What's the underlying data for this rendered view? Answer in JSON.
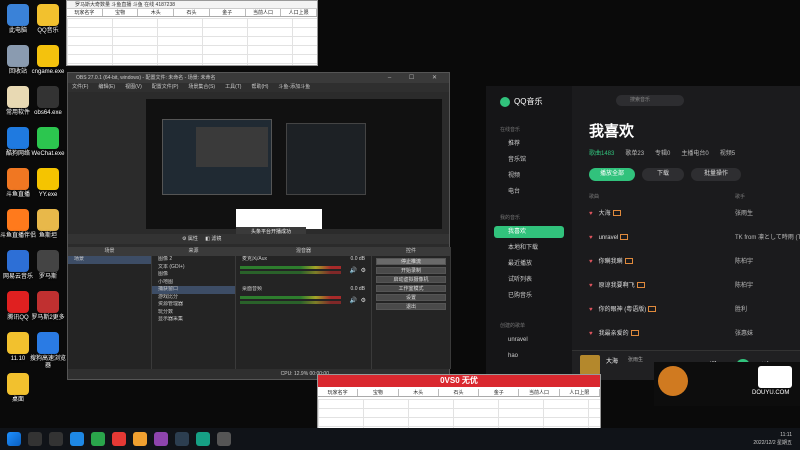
{
  "desktop_icons": [
    {
      "label": "此电脑",
      "color": "#3a82d8"
    },
    {
      "label": "QQ音乐",
      "color": "#f2c12e"
    },
    {
      "label": "回收站",
      "color": "#8a9bb0"
    },
    {
      "label": "cngame.exe",
      "color": "#f4c20d"
    },
    {
      "label": "常用软件",
      "color": "#e8d9b3"
    },
    {
      "label": "obs64.exe",
      "color": "#333333"
    },
    {
      "label": "酷狗网络",
      "color": "#1f7ae0"
    },
    {
      "label": "WeChat.exe",
      "color": "#2cc64f"
    },
    {
      "label": "斗鱼直播",
      "color": "#f07722"
    },
    {
      "label": "YY.exe",
      "color": "#f5c400"
    },
    {
      "label": "斗鱼直播伴侣",
      "color": "#ff7a1c"
    },
    {
      "label": "鱼斯坦",
      "color": "#e8b84a"
    },
    {
      "label": "网易云音乐",
      "color": "#2d6fd6"
    },
    {
      "label": "罗马斯",
      "color": "#444444"
    },
    {
      "label": "腾讯QQ",
      "color": "#e02020"
    },
    {
      "label": "罗马斯2更多",
      "color": "#c03030"
    },
    {
      "label": "11.10",
      "color": "#f2c12e"
    },
    {
      "label": "搜狗高速浏览器",
      "color": "#2a7be4"
    },
    {
      "label": "桌面",
      "color": "#f2c12e"
    }
  ],
  "sheet_top": {
    "title": "罗马斯大奇数量 斗鱼直播 斗鱼 在线 4187238",
    "columns": [
      "玩家名字",
      "宝物",
      "木头",
      "石头",
      "金子",
      "当前人口",
      "人口上限"
    ]
  },
  "sheet_bottom": {
    "columns": [
      "玩家名字",
      "宝物",
      "木头",
      "石头",
      "金子",
      "当前人口",
      "人口上限"
    ],
    "banner": "0VS0 无优"
  },
  "obs": {
    "title": "OBS 27.0.1 (64-bit, windows) - 配置文件: 未命名 - 场景: 未命名",
    "menu": [
      "文件(F)",
      "编辑(E)",
      "视图(V)",
      "配置文件(P)",
      "场景集合(S)",
      "工具(T)",
      "帮助(H)",
      "斗鱼-添加斗鱼"
    ],
    "toast": "头条平台开播成功",
    "toolbar": {
      "props": "属性",
      "filters": "滤镜"
    },
    "docks": {
      "scenes": "场景",
      "sources": "来源",
      "mixer": "混音器",
      "controls": "控件"
    },
    "scene_items": [
      "场景"
    ],
    "source_items": [
      "图像 2",
      "文本 (GDI+)",
      "图像",
      "小地图",
      "捕获窗口",
      "游戏比分",
      "资源管理器",
      "玩分数",
      "显示器采集"
    ],
    "mixer_items": [
      {
        "name": "麦克风/Aux",
        "level": "0.0 dB"
      },
      {
        "name": "桌面音频",
        "level": "0.0 dB"
      }
    ],
    "control_buttons": [
      "停止推流",
      "开始录制",
      "启动虚拟摄像机",
      "工作室模式",
      "设置",
      "退出"
    ],
    "status": "CPU: 12.9%  00:00:00"
  },
  "qq": {
    "brand": "QQ音乐",
    "search_placeholder": "搜索音乐",
    "sections": {
      "online": "在线音乐",
      "mine": "我的音乐",
      "created": "创建的歌单"
    },
    "online_items": [
      "推荐",
      "音乐馆",
      "视频",
      "电台"
    ],
    "mine_items": [
      "我喜欢",
      "本地和下载",
      "最近播放",
      "试听列表",
      "已购音乐"
    ],
    "created_items": [
      "unravel",
      "hao"
    ],
    "page_title": "我喜欢",
    "tabs": [
      "歌曲1483",
      "歌单23",
      "专辑0",
      "主播电台0",
      "视频5"
    ],
    "buttons": {
      "play_all": "播放全部",
      "download": "下载",
      "batch": "批量操作"
    },
    "col_header": "歌曲",
    "col_artist": "歌手",
    "songs": [
      {
        "title": "大海",
        "artist": "张雨生"
      },
      {
        "title": "unravel",
        "artist": "TK from 凛として時雨 (TK fro"
      },
      {
        "title": "你瞒我瞒",
        "artist": "陈柏宇"
      },
      {
        "title": "原谅我要啊飞",
        "artist": "陈柏宇"
      },
      {
        "title": "你的眼神 (粤语版)",
        "artist": "胜利"
      },
      {
        "title": "我最亲爱的",
        "artist": "张惠妹"
      }
    ],
    "player": {
      "song": "大海",
      "artist": "张雨生"
    }
  },
  "overlay": {
    "douyu": "DOUYU.COM",
    "number": "10029976"
  },
  "clock": {
    "time": "11:11",
    "date": "2022/12/2 星期五"
  }
}
